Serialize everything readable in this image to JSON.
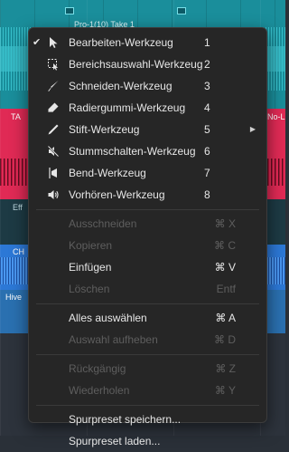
{
  "background": {
    "clip_take_label": "Pro-1(10) Take 1",
    "track_labels": [
      "TA",
      "No-L",
      "Eff",
      "CH",
      "Hive"
    ]
  },
  "menu": {
    "tools": [
      {
        "label": "Bearbeiten-Werkzeug",
        "shortcut": "1",
        "icon": "arrow-pointer-icon",
        "checked": true,
        "submenu": false
      },
      {
        "label": "Bereichsauswahl-Werkzeug",
        "shortcut": "2",
        "icon": "range-select-icon",
        "checked": false,
        "submenu": false
      },
      {
        "label": "Schneiden-Werkzeug",
        "shortcut": "3",
        "icon": "knife-icon",
        "checked": false,
        "submenu": false
      },
      {
        "label": "Radiergummi-Werkzeug",
        "shortcut": "4",
        "icon": "eraser-icon",
        "checked": false,
        "submenu": false
      },
      {
        "label": "Stift-Werkzeug",
        "shortcut": "5",
        "icon": "pencil-icon",
        "checked": false,
        "submenu": true
      },
      {
        "label": "Stummschalten-Werkzeug",
        "shortcut": "6",
        "icon": "mute-speaker-icon",
        "checked": false,
        "submenu": false
      },
      {
        "label": "Bend-Werkzeug",
        "shortcut": "7",
        "icon": "bend-icon",
        "checked": false,
        "submenu": false
      },
      {
        "label": "Vorhören-Werkzeug",
        "shortcut": "8",
        "icon": "speaker-icon",
        "checked": false,
        "submenu": false
      }
    ],
    "edit": [
      {
        "label": "Ausschneiden",
        "shortcut": "⌘ X",
        "enabled": false
      },
      {
        "label": "Kopieren",
        "shortcut": "⌘ C",
        "enabled": false
      },
      {
        "label": "Einfügen",
        "shortcut": "⌘ V",
        "enabled": true
      },
      {
        "label": "Löschen",
        "shortcut": "Entf",
        "enabled": false
      }
    ],
    "selection": [
      {
        "label": "Alles auswählen",
        "shortcut": "⌘ A",
        "enabled": true
      },
      {
        "label": "Auswahl aufheben",
        "shortcut": "⌘ D",
        "enabled": false
      }
    ],
    "history": [
      {
        "label": "Rückgängig",
        "shortcut": "⌘ Z",
        "enabled": false
      },
      {
        "label": "Wiederholen",
        "shortcut": "⌘ Y",
        "enabled": false
      }
    ],
    "presets": [
      {
        "label": "Spurpreset speichern...",
        "enabled": true
      },
      {
        "label": "Spurpreset laden...",
        "enabled": true
      }
    ]
  },
  "colors": {
    "menu_bg": "#262626",
    "text_enabled": "#e6e6e6",
    "text_disabled": "#5e5e5e",
    "track_cyan": "#1a8e9b",
    "track_red": "#e02a55",
    "track_blue": "#2c78d6"
  }
}
